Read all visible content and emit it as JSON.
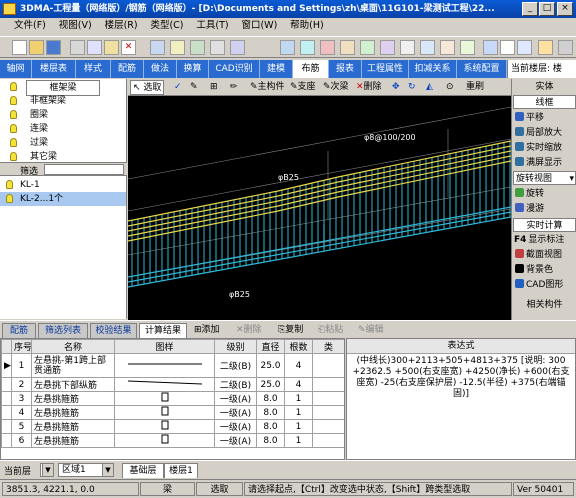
{
  "window": {
    "title": "3DMA-工程量（网络版）/钢筋（网络版）- [D:\\Documents and Settings\\zh\\桌面\\11G101-梁测试工程\\22..."
  },
  "menubar": {
    "items": [
      "文件(F)",
      "视图(V)",
      "楼层(R)",
      "类型(C)",
      "工具(T)",
      "窗口(W)",
      "帮助(H)"
    ]
  },
  "tabs": {
    "items": [
      "轴网",
      "楼层表",
      "样式",
      "配筋",
      "做法",
      "换算",
      "CAD识别",
      "建模",
      "布筋",
      "报表",
      "工程属性",
      "扣减关系",
      "系统配置"
    ],
    "active": 8
  },
  "current_floor": "当前楼层: 楼",
  "tree": {
    "items": [
      "框架梁",
      "非框架梁",
      "圈梁",
      "连梁",
      "过梁",
      "其它梁"
    ],
    "selected": 0
  },
  "filter": {
    "label": "筛选",
    "items": [
      "KL-1",
      "KL-2...1个"
    ],
    "selected": 1
  },
  "canvas_toolbar": {
    "select": "选取",
    "main_member": "主构件",
    "support": "支座",
    "secondary_beam": "次梁",
    "delete": "删除",
    "redraw": "重刷"
  },
  "canvas_labels": [
    "φ8@100/200",
    "φB25",
    "φB25"
  ],
  "right_panel": {
    "items": [
      "实体",
      "线框",
      "平移",
      "局部放大",
      "实时缩放",
      "满屏显示",
      "旋转视图",
      "旋转",
      "漫游",
      "实时计算",
      "显示标注",
      "截面视图",
      "背景色",
      "CAD图形",
      "相关构件"
    ],
    "f4_key": "F4"
  },
  "bottom_tabs": {
    "items": [
      "配筋",
      "筛选列表",
      "校验结果",
      "计算结果"
    ],
    "active": 3,
    "actions": [
      "添加",
      "删除",
      "复制",
      "粘贴",
      "编辑"
    ]
  },
  "grid": {
    "columns": [
      "序号",
      "名称",
      "图样",
      "级别",
      "直径",
      "根数",
      "类"
    ],
    "rows": [
      {
        "no": "1",
        "name": "左悬挑-第1跨上部贯通筋",
        "grade": "二级(B)",
        "dia": "25.0",
        "count": "4"
      },
      {
        "no": "2",
        "name": "左悬挑下部纵筋",
        "grade": "二级(B)",
        "dia": "25.0",
        "count": "4"
      },
      {
        "no": "3",
        "name": "左悬挑箍筋",
        "grade": "一级(A)",
        "dia": "8.0",
        "count": "1"
      },
      {
        "no": "4",
        "name": "左悬挑箍筋",
        "grade": "一级(A)",
        "dia": "8.0",
        "count": "1"
      },
      {
        "no": "5",
        "name": "左悬挑箍筋",
        "grade": "一级(A)",
        "dia": "8.0",
        "count": "1"
      },
      {
        "no": "6",
        "name": "左悬挑箍筋",
        "grade": "一级(A)",
        "dia": "8.0",
        "count": "1"
      }
    ]
  },
  "expression": {
    "header": "表达式",
    "text": "(中线长)300+2113+505+4813+375 [说明: 300 +2362.5 +500(右支座宽) +4250(净长) +600(右支座宽) -25(右支座保护层) -12.5(半径) +375(右端锚固)]"
  },
  "layer_bar": {
    "layer_label": "当前层",
    "region_select": "区域1",
    "tabs": [
      "基础层",
      "楼层1"
    ]
  },
  "status": {
    "coords": "3851.3, 4221.1, 0.0",
    "type": "梁",
    "mode": "选取",
    "hint": "请选择起点,【Ctrl】改变选中状态,【Shift】跨类型选取",
    "version": "Ver 50401"
  },
  "colors": {
    "tab_bar": "#2a6bd1",
    "rebar_yellow": "#e8d84a",
    "rebar_cyan": "#2fb8d8",
    "canvas_bg": "#000000"
  }
}
